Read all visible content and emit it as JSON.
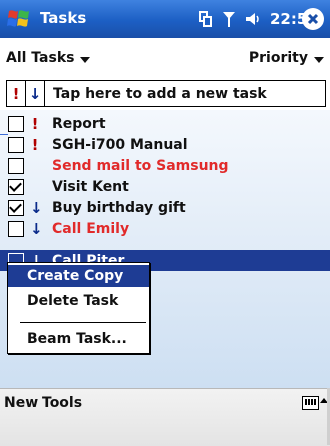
{
  "titlebar": {
    "app_title": "Tasks",
    "clock": "22:59",
    "icons": [
      "windows-start-icon",
      "connectivity-icon",
      "signal-icon",
      "volume-icon",
      "close-icon"
    ]
  },
  "filter": {
    "category": "All Tasks",
    "sort": "Priority"
  },
  "entry": {
    "priority_high": "!",
    "priority_low": "↓",
    "placeholder": "Tap here to add a new task"
  },
  "tasks": [
    {
      "text": "Report",
      "checked": false,
      "priority": "!",
      "color": "#111111"
    },
    {
      "text": "SGH-i700 Manual",
      "checked": false,
      "priority": "!",
      "color": "#111111"
    },
    {
      "text": "Send mail to Samsung",
      "checked": false,
      "priority": "",
      "color": "#e12a2a"
    },
    {
      "text": "Visit Kent",
      "checked": true,
      "priority": "",
      "color": "#111111"
    },
    {
      "text": "Buy birthday gift",
      "checked": true,
      "priority": "↓",
      "color": "#111111"
    },
    {
      "text": "Call Emily",
      "checked": false,
      "priority": "↓",
      "color": "#e12a2a"
    },
    {
      "text": "Call Piter",
      "checked": false,
      "priority": "↓",
      "color": "#ffffff"
    }
  ],
  "context_menu": {
    "items": [
      "Create Copy",
      "Delete Task",
      "Beam Task..."
    ]
  },
  "menubar": {
    "new": "New",
    "tools": "Tools"
  },
  "colors": {
    "titlebar": "#1c5fc4",
    "selection": "#1e3c94",
    "overdue": "#e12a2a",
    "high_priority": "#b00000"
  }
}
